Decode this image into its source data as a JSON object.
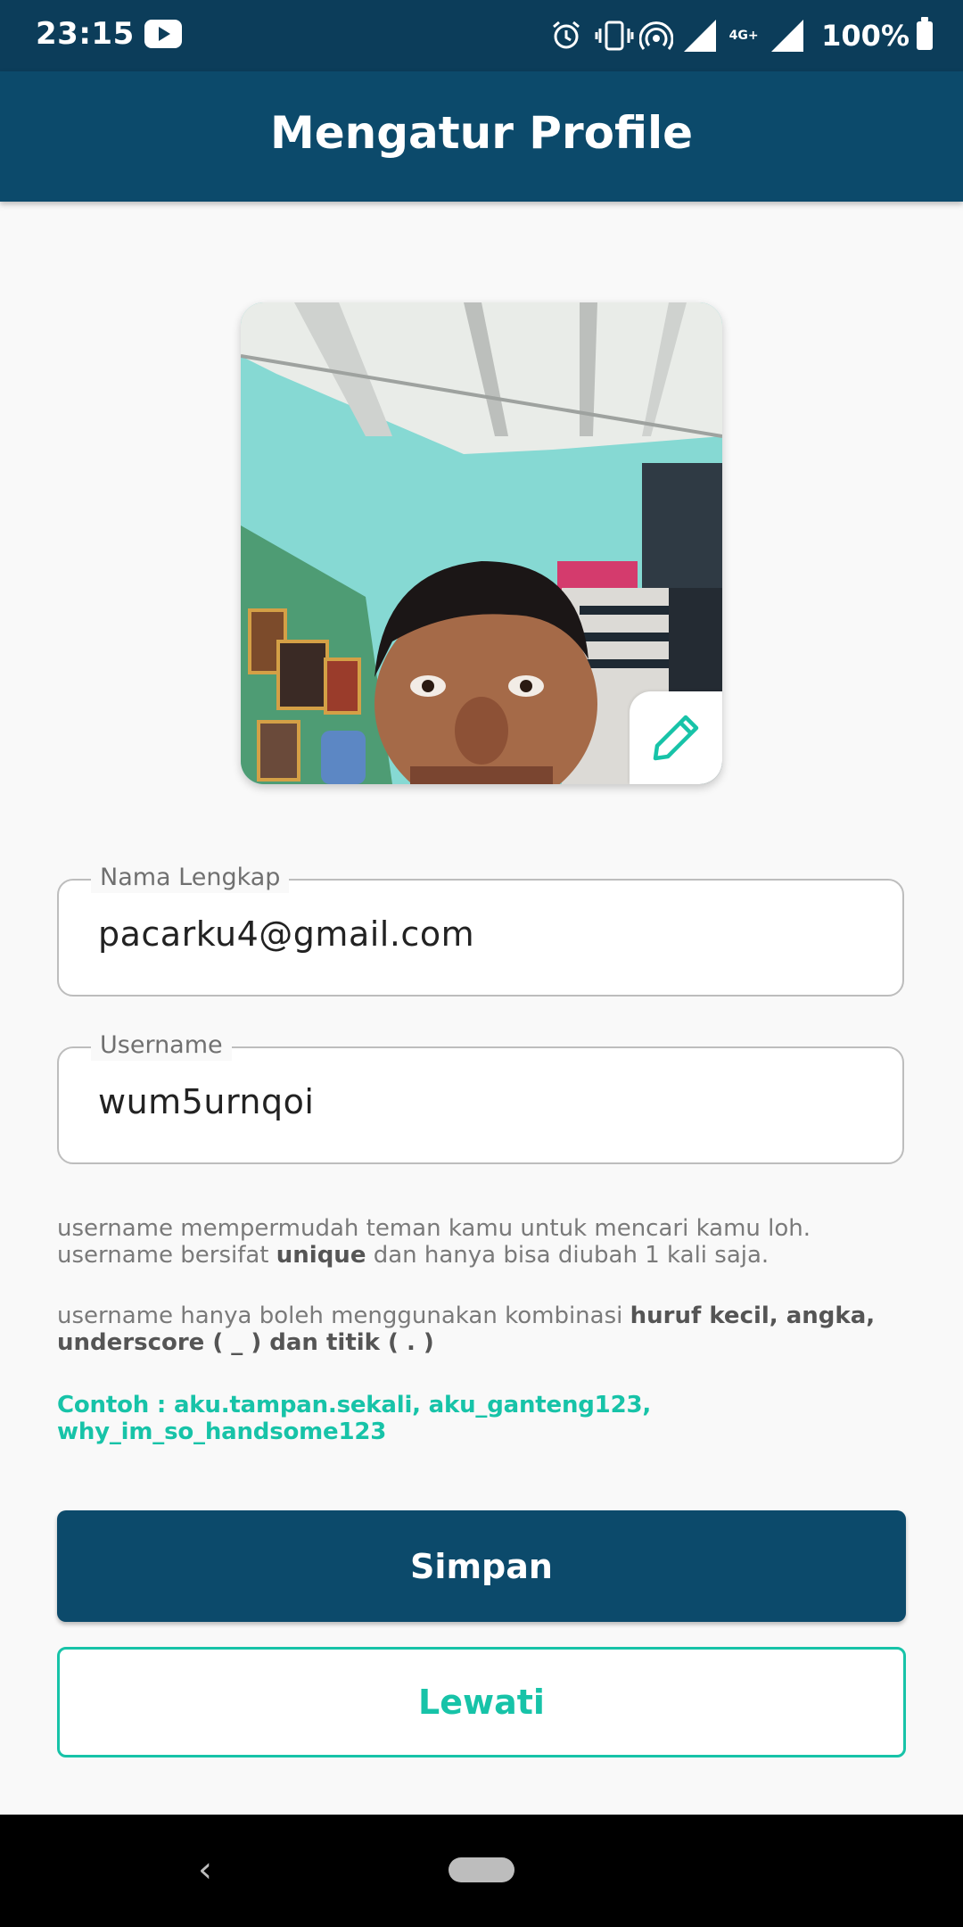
{
  "status_bar": {
    "time": "23:15",
    "battery": "100%",
    "network": "4G+",
    "icons": [
      "youtube-icon",
      "alarm-icon",
      "vibrate-icon",
      "hotspot-icon",
      "signal-icon",
      "network-4g-icon",
      "signal-icon",
      "battery-icon"
    ]
  },
  "app_bar": {
    "title": "Mengatur Profile"
  },
  "profile_photo": {
    "edit_icon": "pencil-icon"
  },
  "form": {
    "full_name": {
      "label": "Nama Lengkap",
      "value": "pacarku4@gmail.com"
    },
    "username": {
      "label": "Username",
      "value": "wum5urnqoi"
    }
  },
  "helper": {
    "line1_a": "username mempermudah teman kamu untuk mencari kamu loh.",
    "line2_a": "username bersifat ",
    "line2_bold": "unique",
    "line2_b": " dan hanya bisa diubah 1 kali saja.",
    "rule_a": "username hanya boleh menggunakan kombinasi ",
    "rule_bold1": "huruf kecil, angka,",
    "rule_bold2": "underscore ( _ ) dan titik ( . )",
    "example": "Contoh : aku.tampan.sekali, aku_ganteng123, why_im_so_handsome123"
  },
  "buttons": {
    "save": "Simpan",
    "skip": "Lewati"
  },
  "nav": {
    "back_glyph": "‹"
  },
  "colors": {
    "primary": "#0c4a6b",
    "accent": "#17c3a8",
    "status_bar": "#0c3d5a"
  }
}
